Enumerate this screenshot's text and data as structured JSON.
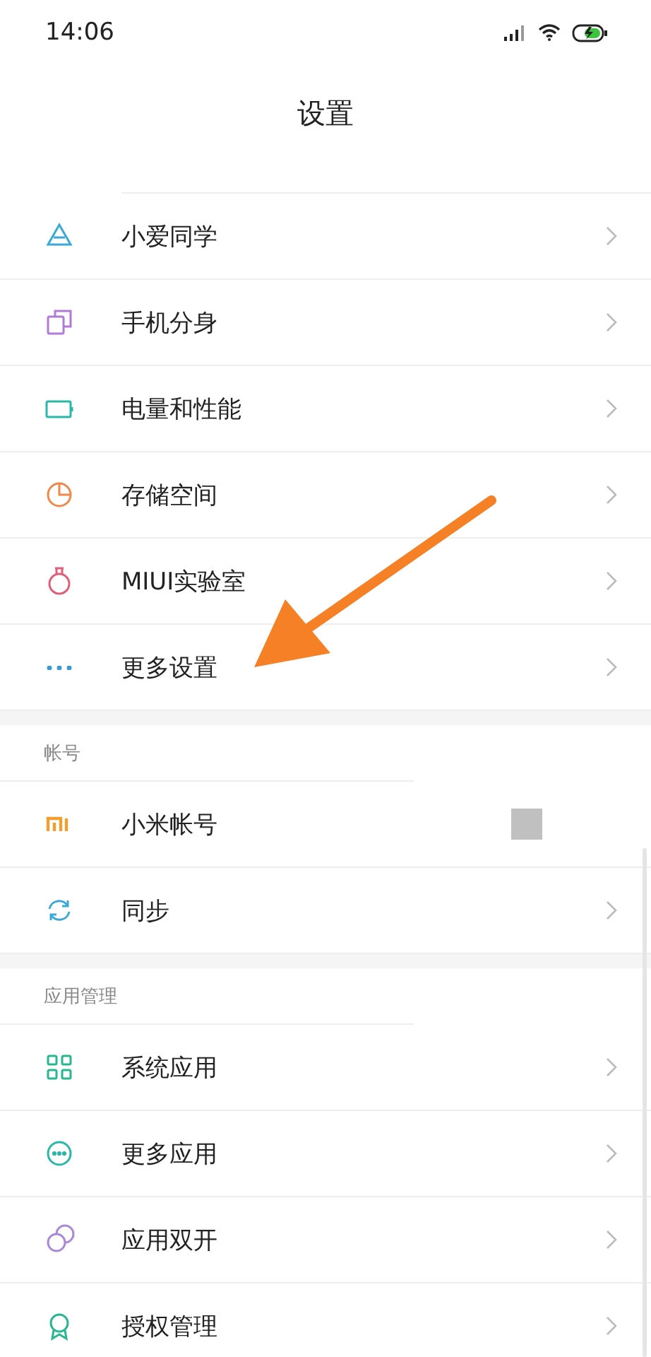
{
  "status_bar": {
    "time": "14:06"
  },
  "title": "设置",
  "sections": [
    {
      "items": [
        {
          "label": "小爱同学",
          "kind": "link"
        },
        {
          "label": "手机分身",
          "kind": "link"
        },
        {
          "label": "电量和性能",
          "kind": "link"
        },
        {
          "label": "存储空间",
          "kind": "link"
        },
        {
          "label": "MIUI实验室",
          "kind": "link"
        },
        {
          "label": "更多设置",
          "kind": "link"
        }
      ]
    },
    {
      "header": "帐号",
      "items": [
        {
          "label": "小米帐号",
          "kind": "redacted"
        },
        {
          "label": "同步",
          "kind": "link"
        }
      ]
    },
    {
      "header": "应用管理",
      "items": [
        {
          "label": "系统应用",
          "kind": "link"
        },
        {
          "label": "更多应用",
          "kind": "link"
        },
        {
          "label": "应用双开",
          "kind": "link"
        },
        {
          "label": "授权管理",
          "kind": "link"
        }
      ]
    }
  ]
}
